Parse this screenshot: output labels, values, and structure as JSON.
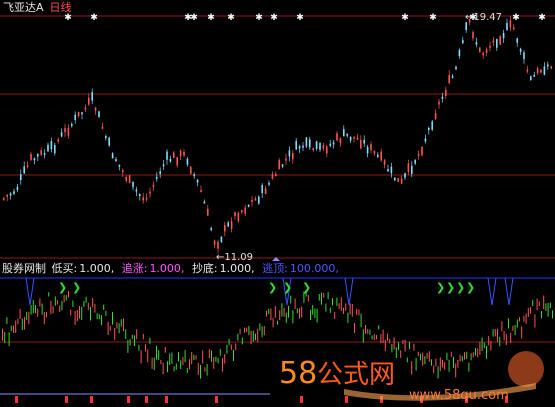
{
  "header": {
    "stock_name": "飞亚达A",
    "period": "日线"
  },
  "annotations": {
    "high_label": "19.47",
    "low_label": "11.09"
  },
  "indicator": {
    "name": "股券网制",
    "params": [
      {
        "label": "低买:",
        "value": "1.000,",
        "color": "#e8e8e8"
      },
      {
        "label": "追涨:",
        "value": "1.000,",
        "color": "#ff55ff"
      },
      {
        "label": "抄底:",
        "value": "1.000,",
        "color": "#e8e8e8"
      },
      {
        "label": "逃顶:",
        "value": "100.000,",
        "color": "#5555ff"
      }
    ]
  },
  "watermark": {
    "brand_num": "58",
    "brand_text": "公式网",
    "url": "www.58gu.com"
  },
  "colors": {
    "up": "#ff5555",
    "down": "#7fe0ff",
    "grid": "#8b1a1a",
    "blue": "#3355ff",
    "green": "#33dd33"
  },
  "chart_data": {
    "type": "candlestick",
    "high": 19.47,
    "low": 11.09,
    "star_markers": 11
  }
}
